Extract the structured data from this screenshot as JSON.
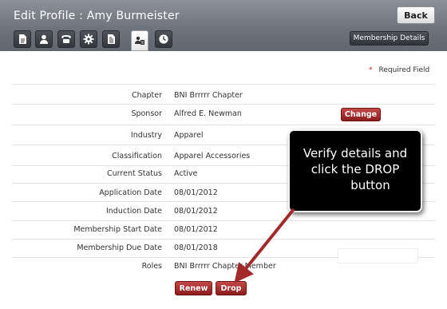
{
  "header": {
    "title": "Edit Profile : Amy Burmeister",
    "back_label": "Back",
    "membership_details_label": "Membership Details",
    "tabs": [
      {
        "icon": "document-icon"
      },
      {
        "icon": "person-icon"
      },
      {
        "icon": "phone-icon"
      },
      {
        "icon": "gear-icon"
      },
      {
        "icon": "list-document-icon"
      },
      {
        "icon": "membership-icon",
        "active": true
      },
      {
        "icon": "clock-icon"
      }
    ]
  },
  "form": {
    "required_marker": "*",
    "required_label": "Required Field",
    "fields": [
      {
        "label": "Chapter",
        "value": "BNI Brrrrr Chapter"
      },
      {
        "label": "Sponsor",
        "value": "Alfred E. Newman"
      },
      {
        "label": "Industry",
        "value": "Apparel"
      },
      {
        "label": "Classification",
        "value": "Apparel Accessories"
      },
      {
        "label": "Current Status",
        "value": "Active"
      },
      {
        "label": "Application Date",
        "value": "08/01/2012"
      },
      {
        "label": "Induction Date",
        "value": "08/01/2012"
      },
      {
        "label": "Membership Start Date",
        "value": "08/01/2012"
      },
      {
        "label": "Membership Due Date",
        "value": "08/01/2018"
      },
      {
        "label": "Roles",
        "value": "BNI Brrrrr Chapter-Member"
      }
    ],
    "change_label": "Change",
    "renew_label": "Renew",
    "drop_label": "Drop"
  },
  "callout": {
    "lines": [
      "Verify details and",
      "click the DROP",
      "button"
    ]
  },
  "colors": {
    "accent_red": "#a32a2a",
    "header_gray": "#6d747c",
    "callout_bg": "#000000"
  }
}
